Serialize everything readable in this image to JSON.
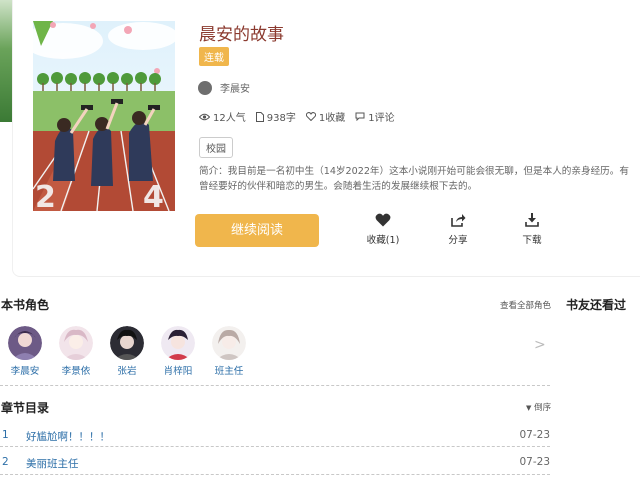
{
  "book": {
    "title": "晨安的故事",
    "status_badge": "连载",
    "author": "李晨安",
    "stats": {
      "popularity": "12人气",
      "words": "938字",
      "favorites": "1收藏",
      "comments": "1评论"
    },
    "tag": "校园",
    "intro": "简介：我目前是一名初中生（14岁2022年）这本小说刚开始可能会很无聊，但是本人的亲身经历。有曾经要好的伙伴和暗恋的男生。会随着生活的发展继续根下去的。"
  },
  "actions": {
    "continue_reading": "继续阅读",
    "favorite": "收藏(1)",
    "share": "分享",
    "download": "下载"
  },
  "characters_section": {
    "title": "本书角色",
    "view_all": "查看全部角色",
    "next_glyph": ">",
    "items": [
      {
        "name": "李晨安"
      },
      {
        "name": "李景依"
      },
      {
        "name": "张岩"
      },
      {
        "name": "肖梓阳"
      },
      {
        "name": "班主任"
      }
    ]
  },
  "friends_section": {
    "title": "书友还看过"
  },
  "chapters_section": {
    "title": "章节目录",
    "sort_label": "倒序",
    "items": [
      {
        "num": "1",
        "title": "好尴尬啊！！！！",
        "date": "07-23"
      },
      {
        "num": "2",
        "title": "美丽班主任",
        "date": "07-23"
      }
    ]
  },
  "colors": {
    "accent": "#f0b64c",
    "title": "#8b3a2f",
    "link": "#2d6fa8"
  },
  "icons": [
    "eye-icon",
    "document-icon",
    "heart-icon",
    "comment-icon",
    "heart-filled-icon",
    "share-icon",
    "download-icon",
    "chevron-right-icon",
    "sort-icon"
  ]
}
